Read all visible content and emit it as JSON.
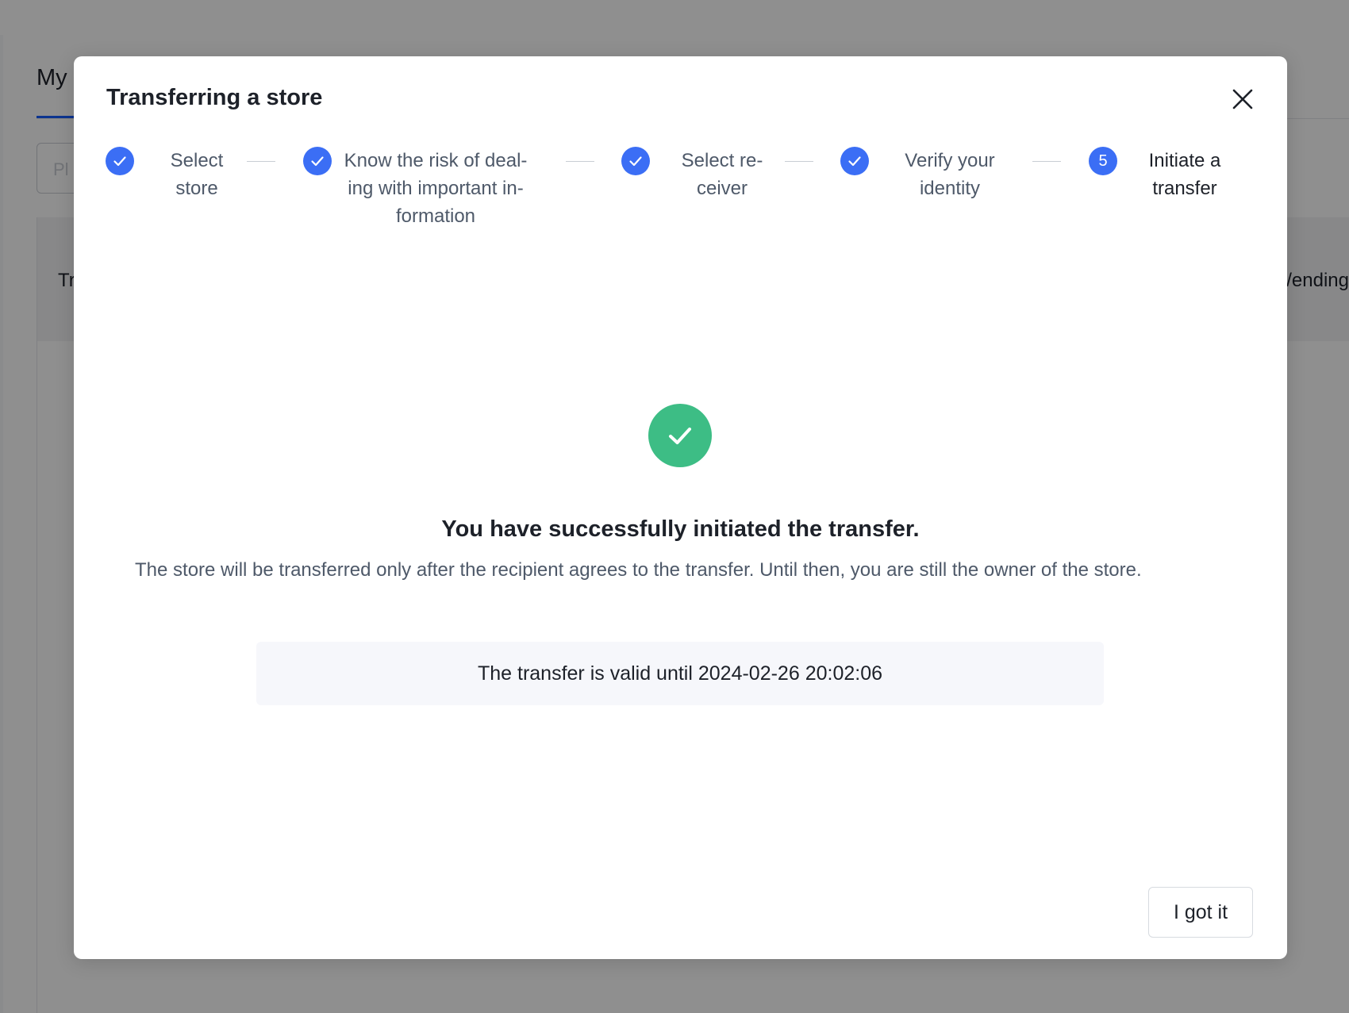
{
  "background": {
    "tab_title": "My",
    "search_placeholder": "Pl",
    "table_header_left": "Tr",
    "table_header_right": "/ending"
  },
  "modal": {
    "title": "Transferring a store",
    "close_icon": "close-icon"
  },
  "steps": [
    {
      "label": "Select store",
      "lines": [
        "Select",
        "store"
      ],
      "state": "done",
      "icon": "check-icon"
    },
    {
      "label": "Know the risk of dealing with important information",
      "lines": [
        "Know the risk of deal-",
        "ing with important in-",
        "formation"
      ],
      "state": "done",
      "icon": "check-icon"
    },
    {
      "label": "Select receiver",
      "lines": [
        "Select re-",
        "ceiver"
      ],
      "state": "done",
      "icon": "check-icon"
    },
    {
      "label": "Verify your identity",
      "lines": [
        "Verify your",
        "identity"
      ],
      "state": "done",
      "icon": "check-icon"
    },
    {
      "label": "Initiate a transfer",
      "lines": [
        "Initiate a",
        "transfer"
      ],
      "state": "active",
      "number": "5"
    }
  ],
  "result": {
    "icon": "success-check-icon",
    "title": "You have successfully initiated the transfer.",
    "description": "The store will be transferred only after the recipient agrees to the transfer. Until then, you are still the owner of the store.",
    "valid_until": "The transfer is valid until 2024-02-26 20:02:06"
  },
  "footer": {
    "confirm_label": "I got it"
  },
  "colors": {
    "primary": "#3b6ef5",
    "success": "#3dbd85",
    "overlay": "rgba(0,0,0,0.44)"
  }
}
